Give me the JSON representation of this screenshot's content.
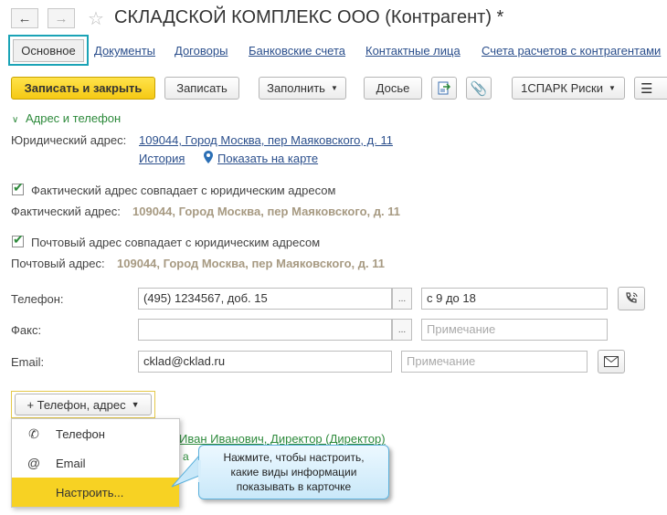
{
  "window": {
    "title": "СКЛАДСКОЙ КОМПЛЕКС ООО (Контрагент) *"
  },
  "tabs": [
    {
      "label": "Основное"
    },
    {
      "label": "Документы"
    },
    {
      "label": "Договоры"
    },
    {
      "label": "Банковские счета"
    },
    {
      "label": "Контактные лица"
    },
    {
      "label": "Счета расчетов с контрагентами"
    }
  ],
  "toolbar": {
    "save_close": "Записать и закрыть",
    "save": "Записать",
    "fill": "Заполнить",
    "dossier": "Досье",
    "spark": "1СПАРК Риски"
  },
  "group": {
    "title": "Адрес и телефон"
  },
  "legal_address": {
    "label": "Юридический адрес:",
    "value": "109044, Город Москва, пер Маяковского, д. 11",
    "history": "История",
    "show_map": "Показать на карте"
  },
  "actual_address": {
    "checkbox_label": "Фактический адрес совпадает с юридическим адресом",
    "checked": true,
    "label": "Фактический адрес:",
    "value": "109044, Город Москва, пер Маяковского, д. 11"
  },
  "postal_address": {
    "checkbox_label": "Почтовый адрес совпадает с юридическим адресом",
    "checked": true,
    "label": "Почтовый адрес:",
    "value": "109044, Город Москва, пер Маяковского, д. 11"
  },
  "phone": {
    "label": "Телефон:",
    "value": "(495) 1234567, доб. 15",
    "note": "с 9 до 18"
  },
  "fax": {
    "label": "Факс:",
    "value": "",
    "note_placeholder": "Примечание"
  },
  "email": {
    "label": "Email:",
    "value": "cklad@cklad.ru",
    "note_placeholder": "Примечание"
  },
  "add_button": {
    "label": "+ Телефон, адрес"
  },
  "menu": {
    "items": [
      {
        "icon": "phone-icon",
        "label": "Телефон"
      },
      {
        "icon": "at-icon",
        "label": "Email"
      },
      {
        "icon": "",
        "label": "Настроить..."
      }
    ],
    "highlight_color": "#f7d223"
  },
  "contact_partial": "Иван Иванович, Директор (Директор)",
  "tooltip": {
    "text": "Нажмите, чтобы настроить, какие виды информации показывать в карточке"
  },
  "colors": {
    "accent": "#f5c914",
    "link": "#2b4f8c",
    "group_green": "#2d8a3b",
    "tab_highlight": "#1aa3b6"
  }
}
